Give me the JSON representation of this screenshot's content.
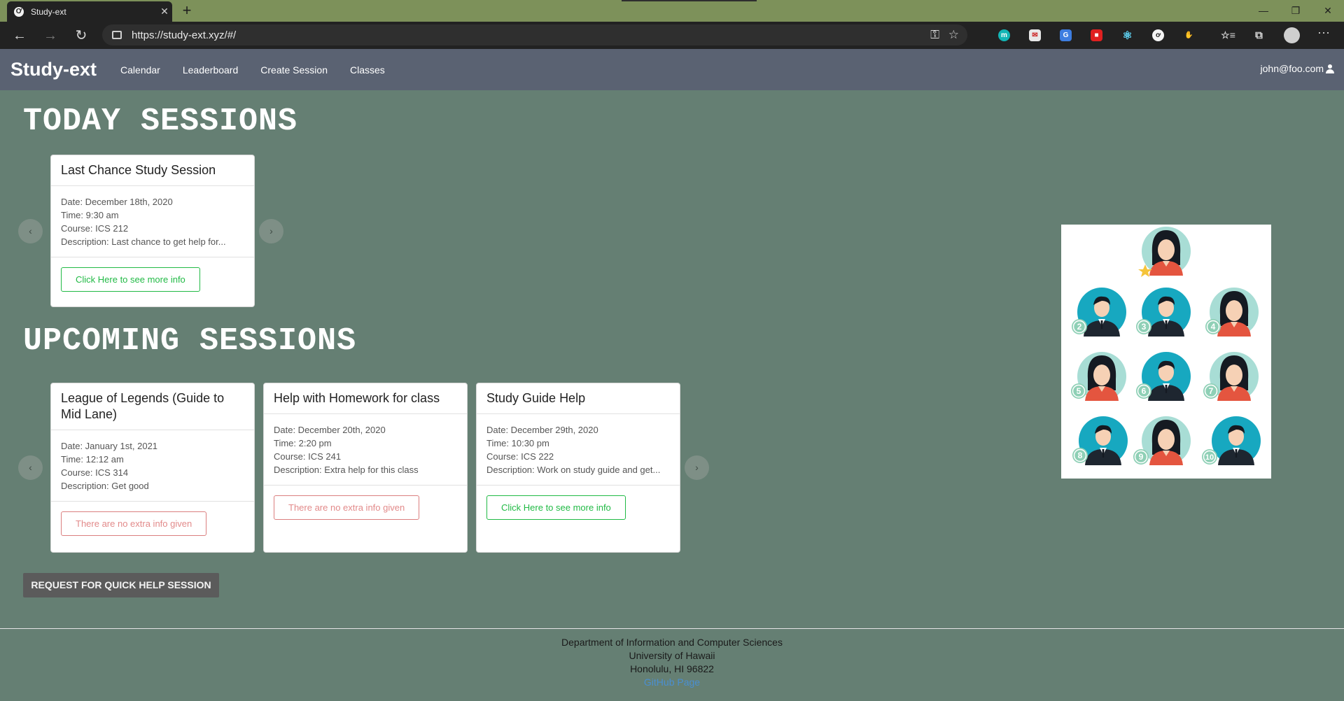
{
  "browser": {
    "tab_title": "Study-ext",
    "tab_favicon": "Ơ",
    "close_glyph": "✕",
    "newtab_glyph": "+",
    "url": "https://study-ext.xyz/#/",
    "window_controls": {
      "minimize": "—",
      "restore": "❐",
      "close": "✕"
    },
    "nav": {
      "back": "←",
      "forward": "→",
      "reload": "↻"
    },
    "tools": {
      "key": "⚿",
      "star": "☆",
      "favorites": "☆≡",
      "collections": "⧉",
      "menu": "···"
    }
  },
  "site": {
    "brand": "Study-ext",
    "nav_links": [
      "Calendar",
      "Leaderboard",
      "Create Session",
      "Classes"
    ],
    "user": "john@foo.com"
  },
  "today": {
    "title": "TODAY SESSIONS",
    "cards": [
      {
        "title": "Last Chance Study Session",
        "date": "Date: December 18th, 2020",
        "time": "Time: 9:30 am",
        "course": "Course: ICS 212",
        "description": "Description: Last chance to get help for...",
        "button": "Click Here to see more info"
      }
    ]
  },
  "upcoming": {
    "title": "UPCOMING SESSIONS",
    "cards": [
      {
        "title": "League of Legends (Guide to Mid Lane)",
        "date": "Date: January 1st, 2021",
        "time": "Time: 12:12 am",
        "course": "Course: ICS 314",
        "description": "Description: Get good",
        "button": "There are no extra info given"
      },
      {
        "title": "Help with Homework for class",
        "date": "Date: December 20th, 2020",
        "time": "Time: 2:20 pm",
        "course": "Course: ICS 241",
        "description": "Description: Extra help for this class",
        "button": "There are no extra info given"
      },
      {
        "title": "Study Guide Help",
        "date": "Date: December 29th, 2020",
        "time": "Time: 10:30 pm",
        "course": "Course: ICS 222",
        "description": "Description: Work on study guide and get...",
        "button": "Click Here to see more info"
      }
    ]
  },
  "carousel": {
    "prev": "‹",
    "next": "›"
  },
  "quick_help_button": "REQUEST FOR QUICK HELP SESSION",
  "illustration": {
    "numbers": [
      "2",
      "3",
      "4",
      "5",
      "6",
      "7",
      "8",
      "9",
      "10"
    ]
  },
  "footer": {
    "line1": "Department of Information and Computer Sciences",
    "line2": "University of Hawaii",
    "line3": "Honolulu, HI 96822",
    "link": "GitHub Page"
  },
  "colors": {
    "page_bg": "#657f73",
    "navbar_bg": "#5a6272",
    "green_button": "#21ba45",
    "red_button": "#db7f7f",
    "teal_avatar": "#17a8c0",
    "light_teal_avatar": "#a8ddd5"
  }
}
